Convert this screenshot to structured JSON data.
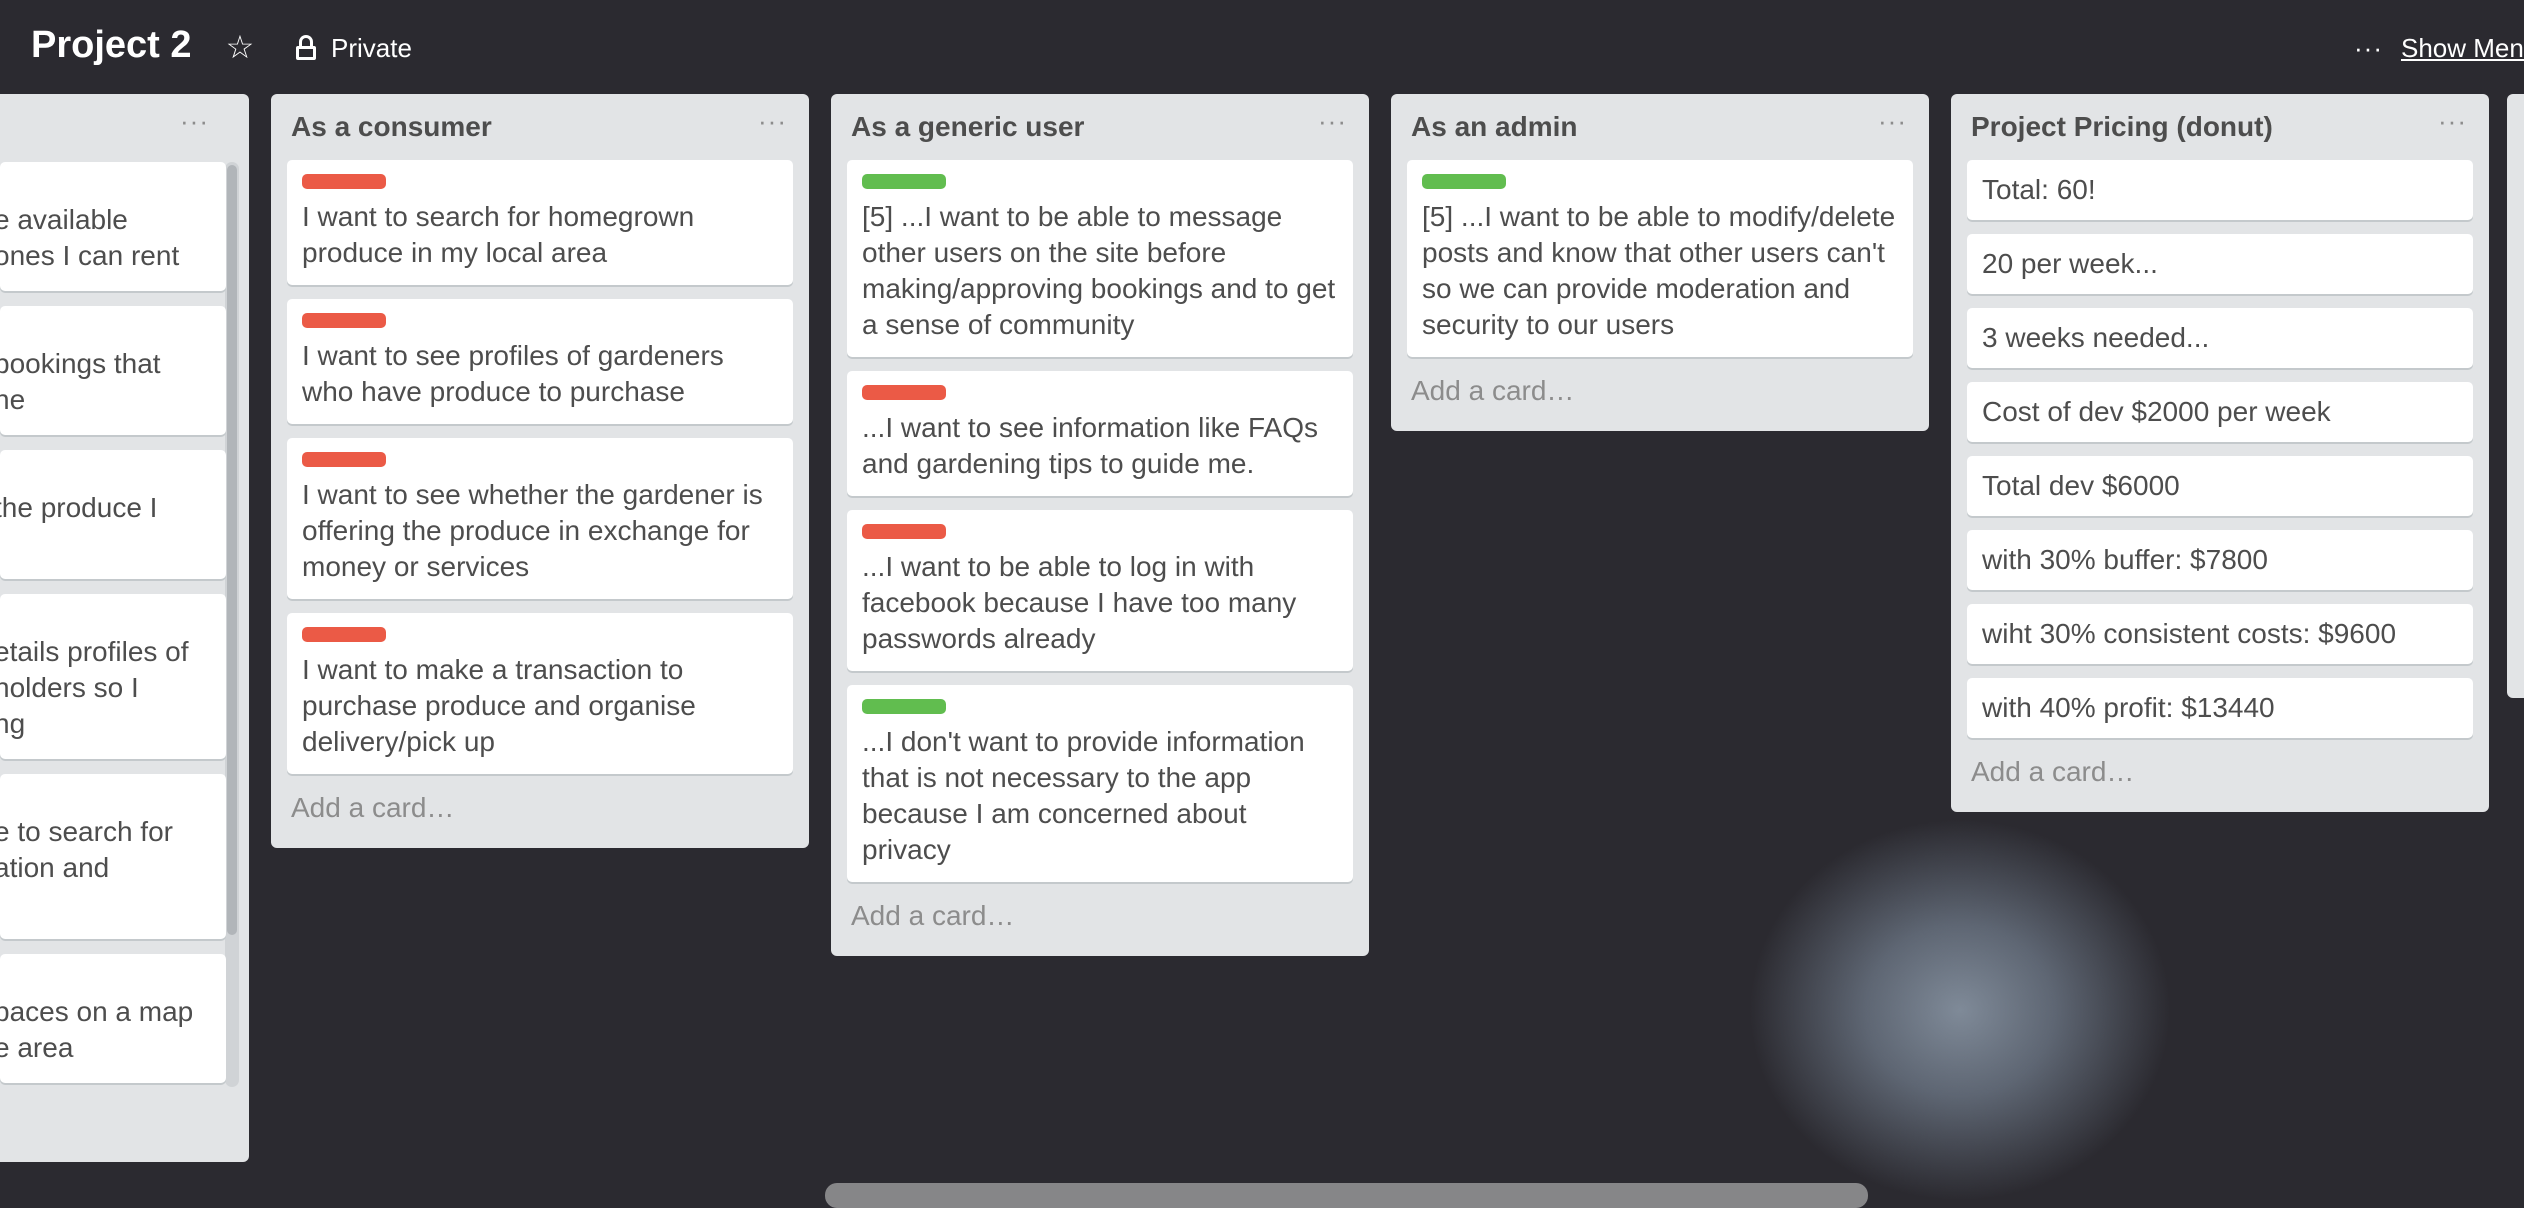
{
  "board": {
    "title": "Project 2",
    "visibility": "Private",
    "menu_label": "Show Menu",
    "star_icon": "star-icon",
    "lock_icon": "lock-icon"
  },
  "left_list": {
    "cards": [
      {
        "line1": "e available",
        "line2": "ones I can rent"
      },
      {
        "line1": "bookings that",
        "line2": "ne"
      },
      {
        "line1": "the produce I",
        "line2": ""
      },
      {
        "line1": "etails profiles of",
        "line2": "holders so I",
        "line3": "ng"
      },
      {
        "line1": "e to search for",
        "line2": "ation and",
        "line3": ""
      },
      {
        "line1": "paces on a map",
        "line2": "e area"
      }
    ]
  },
  "lists": [
    {
      "title": "As a consumer",
      "add_card": "Add a card…",
      "cards": [
        {
          "label": "red",
          "text": "I want to search for homegrown produce in my local area"
        },
        {
          "label": "red",
          "text": "I want to see profiles of gardeners who have produce to purchase"
        },
        {
          "label": "red",
          "text": "I want to see whether the gardener is offering the produce in exchange for money or services"
        },
        {
          "label": "red",
          "text": "I want to make a transaction to purchase produce and organise delivery/pick up"
        }
      ]
    },
    {
      "title": "As a generic user",
      "add_card": "Add a card…",
      "cards": [
        {
          "label": "green",
          "text": "[5] ...I want to be able to message other users on the site before making/approving bookings and to get a sense of community"
        },
        {
          "label": "red",
          "text": "...I want to see information like FAQs and gardening tips to guide me."
        },
        {
          "label": "red",
          "text": "...I want to be able to log in with facebook because I have too many passwords already"
        },
        {
          "label": "green",
          "text": "...I don't want to provide information that is not necessary to the app because I am concerned about privacy"
        }
      ]
    },
    {
      "title": "As an admin",
      "add_card": "Add a card…",
      "cards": [
        {
          "label": "green",
          "text": "[5] ...I want to be able to modify/delete posts and know that other users can't so we can provide moderation and security to our users"
        }
      ]
    },
    {
      "title": "Project Pricing (donut)",
      "add_card": "Add a card…",
      "cards": [
        {
          "text": "Total: 60!"
        },
        {
          "text": "20 per week..."
        },
        {
          "text": "3 weeks needed..."
        },
        {
          "text": "Cost of dev $2000 per week"
        },
        {
          "text": "Total dev $6000"
        },
        {
          "text": "with 30% buffer: $7800"
        },
        {
          "text": "wiht 30% consistent costs: $9600"
        },
        {
          "text": "with 40% profit: $13440"
        }
      ]
    }
  ],
  "colors": {
    "label_red": "#eb5a46",
    "label_green": "#61bd4f",
    "list_bg": "#e2e4e6"
  }
}
